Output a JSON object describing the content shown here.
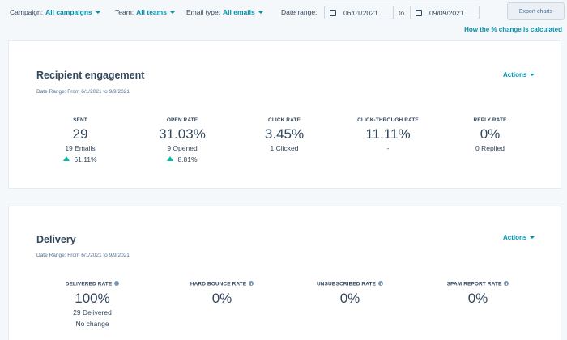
{
  "filters": {
    "campaign_label": "Campaign:",
    "campaign_value": "All campaigns",
    "team_label": "Team:",
    "team_value": "All teams",
    "email_type_label": "Email type:",
    "email_type_value": "All emails",
    "date_range_label": "Date range:",
    "date_from": "06/01/2021",
    "date_to_label": "to",
    "date_to": "09/09/2021",
    "export_label": "Export charts"
  },
  "how_link": "How the % change is calculated",
  "engagement": {
    "title": "Recipient engagement",
    "date_range": "Date Range: From 6/1/2021 to 9/9/2021",
    "actions_label": "Actions",
    "metrics": [
      {
        "label": "SENT",
        "value": "29",
        "sub": "19 Emails",
        "change": "61.11%"
      },
      {
        "label": "OPEN RATE",
        "value": "31.03%",
        "sub": "9 Opened",
        "change": "8.81%"
      },
      {
        "label": "CLICK RATE",
        "value": "3.45%",
        "sub": "1 Clicked"
      },
      {
        "label": "CLICK-THROUGH RATE",
        "value": "11.11%",
        "sub": "-"
      },
      {
        "label": "REPLY RATE",
        "value": "0%",
        "sub": "0 Replied"
      }
    ]
  },
  "delivery": {
    "title": "Delivery",
    "date_range": "Date Range: From 6/1/2021 to 9/9/2021",
    "actions_label": "Actions",
    "metrics": [
      {
        "label": "DELIVERED RATE",
        "value": "100%",
        "sub": "29 Delivered",
        "change": "No change"
      },
      {
        "label": "HARD BOUNCE RATE",
        "value": "0%"
      },
      {
        "label": "UNSUBSCRIBED RATE",
        "value": "0%"
      },
      {
        "label": "SPAM REPORT RATE",
        "value": "0%"
      }
    ]
  },
  "icons": {
    "calendar": "calendar-icon",
    "caret": "chevron-down-icon",
    "trend_up": "triangle-up-icon",
    "info": "info-icon"
  },
  "colors": {
    "accent": "#0091ae",
    "text": "#33475b",
    "positive": "#00bda5",
    "background": "#f5f8fa"
  }
}
